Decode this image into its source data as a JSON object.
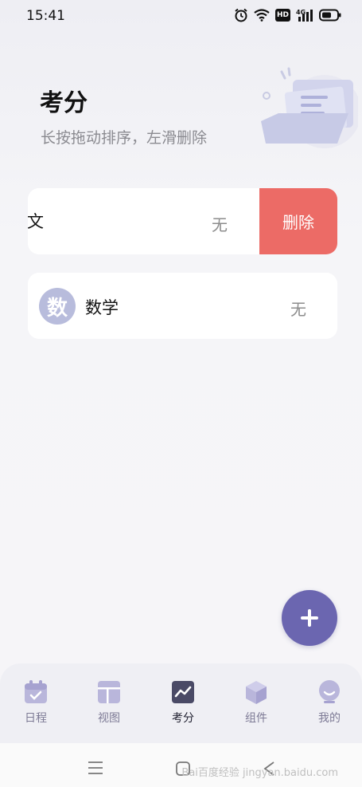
{
  "status_bar": {
    "time": "15:41",
    "hd_badge": "HD",
    "network": "4G"
  },
  "header": {
    "title": "考分",
    "subtitle": "长按拖动排序，左滑删除"
  },
  "subjects": [
    {
      "name_visible": "文",
      "score": "无",
      "delete_label": "删除",
      "swiped": true
    },
    {
      "avatar": "数",
      "name": "数学",
      "score": "无",
      "swiped": false
    }
  ],
  "tabs": [
    {
      "label": "日程",
      "icon": "calendar-icon",
      "active": false
    },
    {
      "label": "视图",
      "icon": "layout-icon",
      "active": false
    },
    {
      "label": "考分",
      "icon": "chart-icon",
      "active": true
    },
    {
      "label": "组件",
      "icon": "cube-icon",
      "active": false
    },
    {
      "label": "我的",
      "icon": "user-icon",
      "active": false
    }
  ],
  "watermark": "Bai百度经验 jingyan.baidu.com",
  "colors": {
    "accent": "#6b66b0",
    "delete": "#ec6b66",
    "avatar": "#b8bcdc",
    "tab_icon": "#b9b6db"
  }
}
